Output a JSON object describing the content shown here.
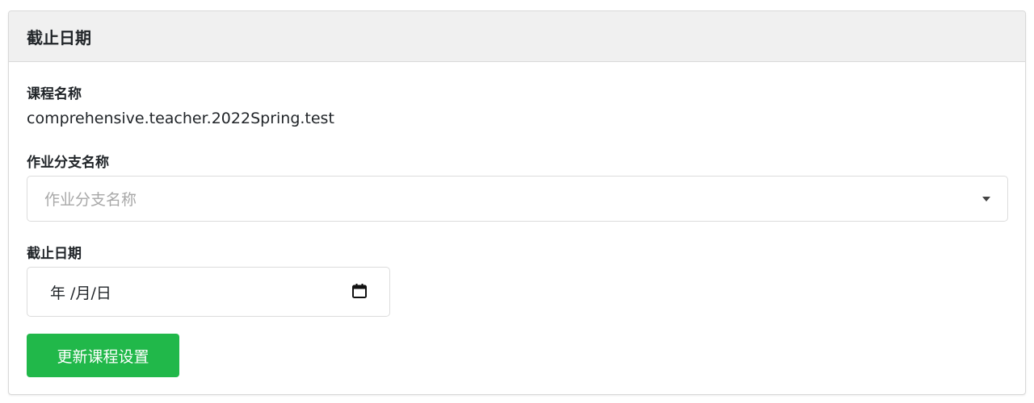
{
  "card": {
    "title": "截止日期"
  },
  "course": {
    "label": "课程名称",
    "value": "comprehensive.teacher.2022Spring.test"
  },
  "branch": {
    "label": "作业分支名称",
    "placeholder": "作业分支名称"
  },
  "deadline": {
    "label": "截止日期",
    "value": "年 /月/日"
  },
  "submit": {
    "label": "更新课程设置"
  },
  "colors": {
    "accent": "#21b84a",
    "header_bg": "#f0f0f0"
  }
}
